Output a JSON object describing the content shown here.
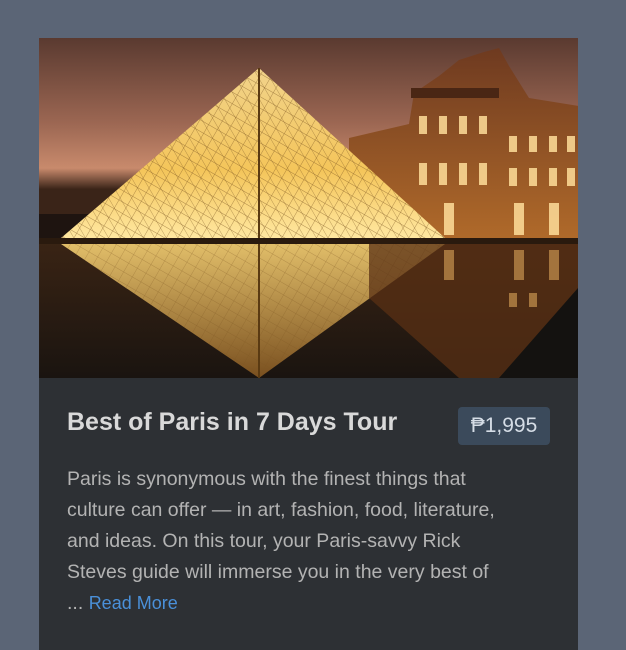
{
  "card": {
    "image_alt": "Louvre pyramid at dusk",
    "title": "Best of Paris in 7 Days Tour",
    "price": "₱1,995",
    "description_lines": [
      "Paris is synonymous with the finest things that",
      "culture can offer — in art, fashion, food, literature,",
      "and ideas. On this tour, your Paris-savvy Rick",
      "Steves guide will immerse you in the very best of"
    ],
    "ellipsis": "...",
    "read_more_label": "Read More"
  },
  "colors": {
    "page_background": "#5b6576",
    "card_background": "#2d3034",
    "title_text": "#d9d9d9",
    "price_badge_background": "#3b4a5b",
    "link": "#4a90d9"
  }
}
